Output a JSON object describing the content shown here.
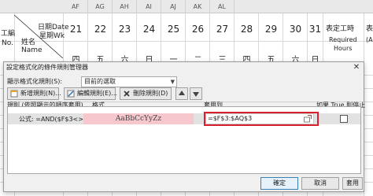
{
  "sheet": {
    "columns": [
      "AF",
      "AG",
      "AH",
      "AI",
      "AJ",
      "AK",
      "AL"
    ],
    "header_left": {
      "daily_line": "日期Date",
      "week_line": "星期Wk",
      "left_frag_1": "工編",
      "left_frag_2": "No.",
      "name_zh": "姓名",
      "name_en": "Name"
    },
    "days": [
      "21",
      "22",
      "23",
      "24",
      "25",
      "26",
      "27",
      "28",
      "29",
      "30",
      "31"
    ],
    "weekdays": [
      "四",
      "五",
      "六",
      "日",
      "一",
      "二",
      "三",
      "四",
      "五",
      "六",
      "日"
    ],
    "right_col": {
      "line1": "表定工時",
      "line2": "Required",
      "line3": "Hours",
      "frag": "表",
      "frag2": "(A"
    }
  },
  "dialog": {
    "title": "設定格式化的條件規則管理器",
    "close_glyph": "✕",
    "show_rules_label": "顯示格式化規則(S):",
    "show_rules_value": "目前的選取",
    "buttons": {
      "new_rule": "新增規則(N)...",
      "edit_rule": "編輯規則(E)...",
      "delete_rule": "刪除規則(D)",
      "ok": "確定",
      "cancel": "取消",
      "apply": "套用"
    },
    "list_header": {
      "rule": "規則 (依照顯示的順序套用)",
      "format": "格式",
      "applies_to": "套用到",
      "stop_if_true": "如果 True 則停止"
    },
    "rule": {
      "text": "公式: =AND($F$3<>...",
      "format_preview": "AaBbCcYyZz",
      "applies_to": "=$F$3:$AQ$3"
    }
  },
  "colors": {
    "highlight": "#d9202e",
    "preview_fill": "#f6c8cd"
  }
}
